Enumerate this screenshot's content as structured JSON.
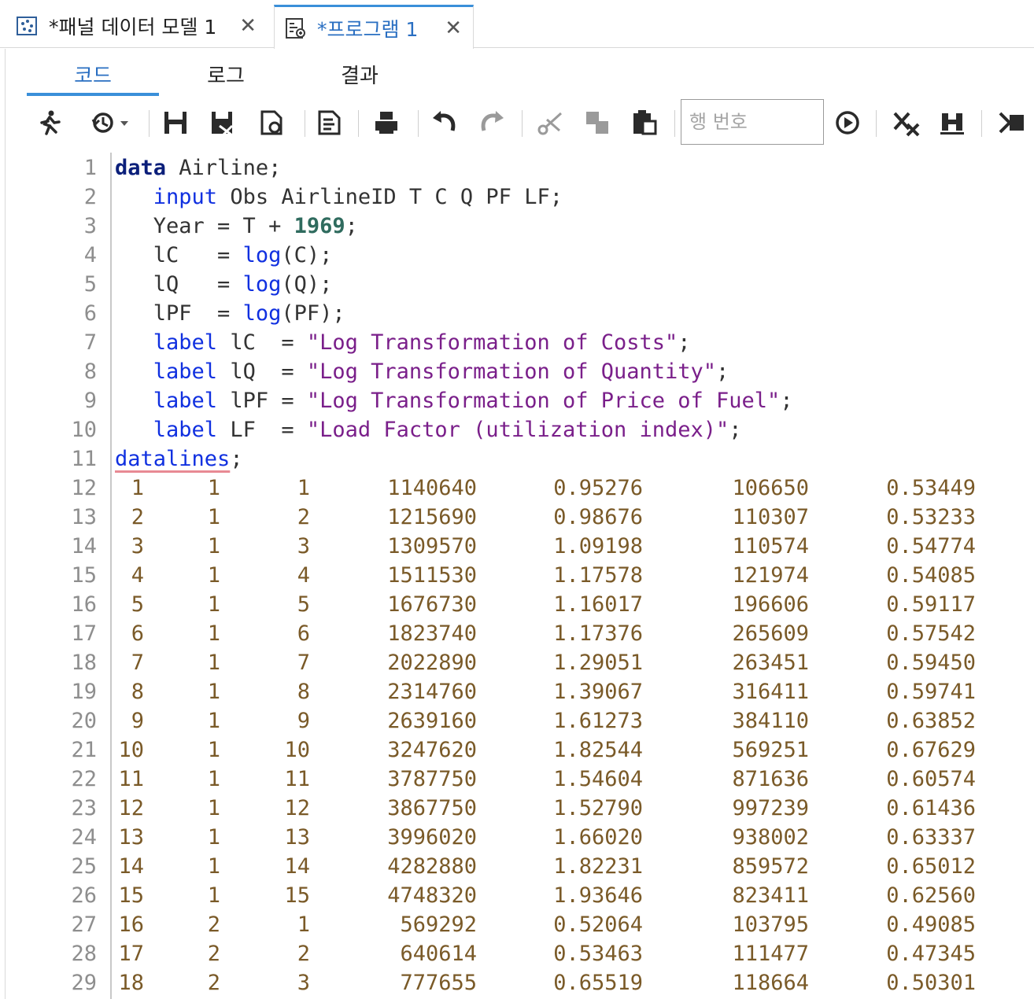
{
  "doc_tabs": [
    {
      "label": "*패널 데이터 모델 1",
      "close": "✕",
      "icon": "panel-data-model-icon"
    },
    {
      "label": "*프로그램 1",
      "close": "✕",
      "icon": "program-icon",
      "active": true
    }
  ],
  "sub_tabs": [
    {
      "label": "코드",
      "active": true
    },
    {
      "label": "로그"
    },
    {
      "label": "결과"
    }
  ],
  "toolbar": {
    "line_number_placeholder": "행 번호",
    "icons": [
      "run-icon",
      "history-icon",
      "save-icon",
      "save-as-icon",
      "export-icon",
      "format-icon",
      "print-icon",
      "undo-icon",
      "redo-icon",
      "cut-icon",
      "copy-icon",
      "paste-icon",
      "submit-line-icon",
      "clear-icon",
      "analyze-icon",
      "expand-icon"
    ]
  },
  "code": {
    "lines": [
      {
        "n": "1",
        "tokens": [
          [
            "kw-bold",
            "data"
          ],
          [
            "id",
            " Airline;"
          ]
        ]
      },
      {
        "n": "2",
        "tokens": [
          [
            "id",
            "   "
          ],
          [
            "kw",
            "input"
          ],
          [
            "id",
            " Obs AirlineID T C Q PF LF;"
          ]
        ]
      },
      {
        "n": "3",
        "tokens": [
          [
            "id",
            "   Year = T + "
          ],
          [
            "num",
            "1969"
          ],
          [
            "id",
            ";"
          ]
        ]
      },
      {
        "n": "4",
        "tokens": [
          [
            "id",
            "   lC   = "
          ],
          [
            "kw",
            "log"
          ],
          [
            "id",
            "(C);"
          ]
        ]
      },
      {
        "n": "5",
        "tokens": [
          [
            "id",
            "   lQ   = "
          ],
          [
            "kw",
            "log"
          ],
          [
            "id",
            "(Q);"
          ]
        ]
      },
      {
        "n": "6",
        "tokens": [
          [
            "id",
            "   lPF  = "
          ],
          [
            "kw",
            "log"
          ],
          [
            "id",
            "(PF);"
          ]
        ]
      },
      {
        "n": "7",
        "tokens": [
          [
            "id",
            "   "
          ],
          [
            "kw",
            "label"
          ],
          [
            "id",
            " lC  = "
          ],
          [
            "str",
            "\"Log Transformation of Costs\""
          ],
          [
            "id",
            ";"
          ]
        ]
      },
      {
        "n": "8",
        "tokens": [
          [
            "id",
            "   "
          ],
          [
            "kw",
            "label"
          ],
          [
            "id",
            " lQ  = "
          ],
          [
            "str",
            "\"Log Transformation of Quantity\""
          ],
          [
            "id",
            ";"
          ]
        ]
      },
      {
        "n": "9",
        "tokens": [
          [
            "id",
            "   "
          ],
          [
            "kw",
            "label"
          ],
          [
            "id",
            " lPF = "
          ],
          [
            "str",
            "\"Log Transformation of Price of Fuel\""
          ],
          [
            "id",
            ";"
          ]
        ]
      },
      {
        "n": "10",
        "tokens": [
          [
            "id",
            "   "
          ],
          [
            "kw",
            "label"
          ],
          [
            "id",
            " LF  = "
          ],
          [
            "str",
            "\"Load Factor (utilization index)\""
          ],
          [
            "id",
            ";"
          ]
        ]
      },
      {
        "n": "11",
        "tokens": [
          [
            "kw underline-red",
            "datalines"
          ],
          [
            "id",
            ";"
          ]
        ]
      }
    ],
    "data_rows": [
      [
        "12",
        " 1",
        "1",
        "1",
        "1140640",
        "0.95276",
        "106650",
        "0.53449"
      ],
      [
        "13",
        " 2",
        "1",
        "2",
        "1215690",
        "0.98676",
        "110307",
        "0.53233"
      ],
      [
        "14",
        " 3",
        "1",
        "3",
        "1309570",
        "1.09198",
        "110574",
        "0.54774"
      ],
      [
        "15",
        " 4",
        "1",
        "4",
        "1511530",
        "1.17578",
        "121974",
        "0.54085"
      ],
      [
        "16",
        " 5",
        "1",
        "5",
        "1676730",
        "1.16017",
        "196606",
        "0.59117"
      ],
      [
        "17",
        " 6",
        "1",
        "6",
        "1823740",
        "1.17376",
        "265609",
        "0.57542"
      ],
      [
        "18",
        " 7",
        "1",
        "7",
        "2022890",
        "1.29051",
        "263451",
        "0.59450"
      ],
      [
        "19",
        " 8",
        "1",
        "8",
        "2314760",
        "1.39067",
        "316411",
        "0.59741"
      ],
      [
        "20",
        " 9",
        "1",
        "9",
        "2639160",
        "1.61273",
        "384110",
        "0.63852"
      ],
      [
        "21",
        "10",
        "1",
        "10",
        "3247620",
        "1.82544",
        "569251",
        "0.67629"
      ],
      [
        "22",
        "11",
        "1",
        "11",
        "3787750",
        "1.54604",
        "871636",
        "0.60574"
      ],
      [
        "23",
        "12",
        "1",
        "12",
        "3867750",
        "1.52790",
        "997239",
        "0.61436"
      ],
      [
        "24",
        "13",
        "1",
        "13",
        "3996020",
        "1.66020",
        "938002",
        "0.63337"
      ],
      [
        "25",
        "14",
        "1",
        "14",
        "4282880",
        "1.82231",
        "859572",
        "0.65012"
      ],
      [
        "26",
        "15",
        "1",
        "15",
        "4748320",
        "1.93646",
        "823411",
        "0.62560"
      ],
      [
        "27",
        "16",
        "2",
        "1",
        "569292",
        "0.52064",
        "103795",
        "0.49085"
      ],
      [
        "28",
        "17",
        "2",
        "2",
        "640614",
        "0.53463",
        "111477",
        "0.47345"
      ],
      [
        "29",
        "18",
        "2",
        "3",
        "777655",
        "0.65519",
        "118664",
        "0.50301"
      ]
    ]
  }
}
